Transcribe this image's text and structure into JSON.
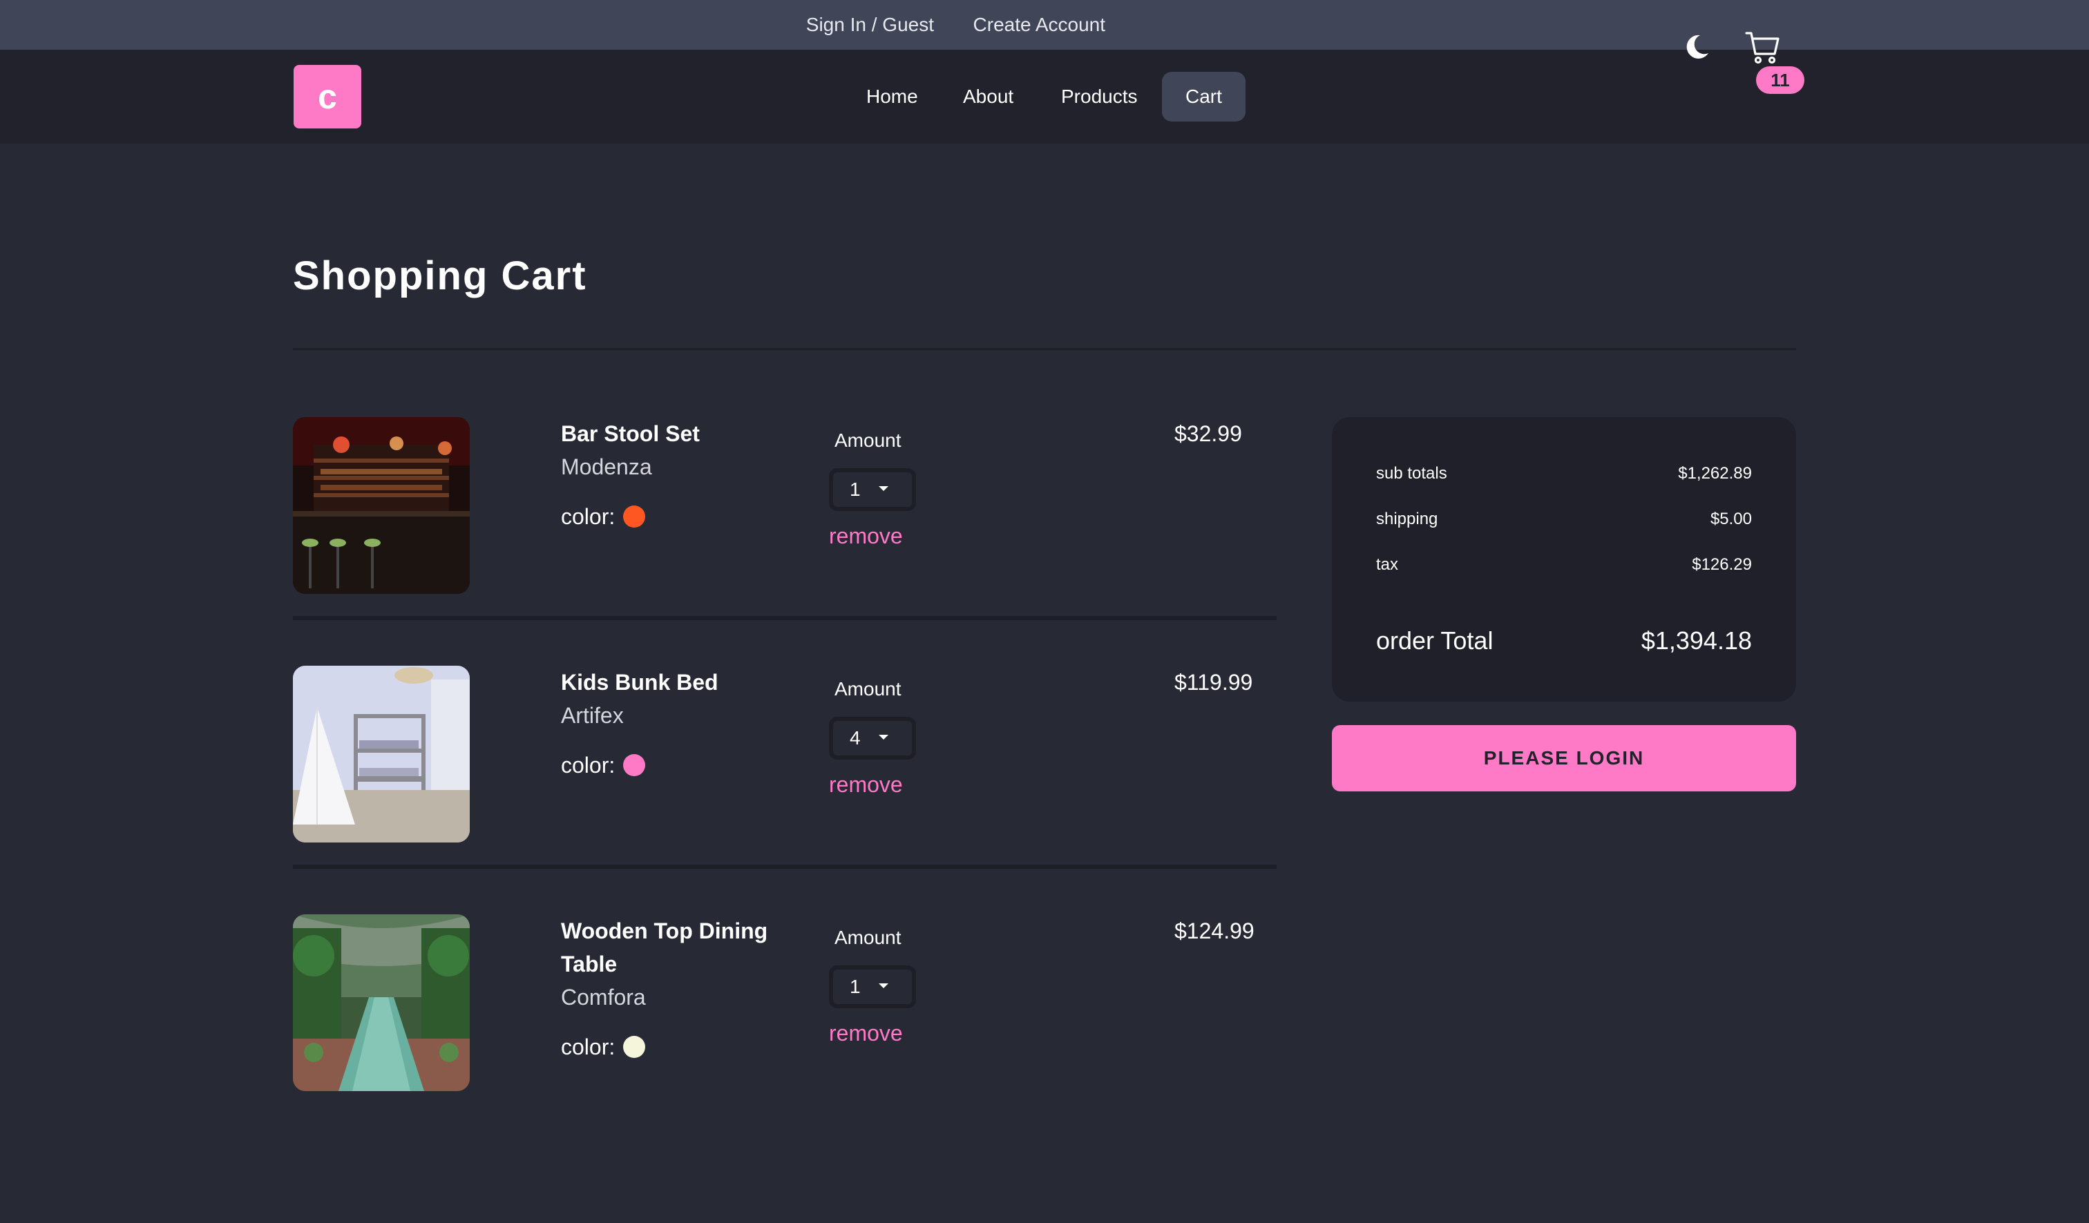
{
  "topbar": {
    "sign_in": "Sign In / Guest",
    "create_account": "Create Account"
  },
  "navbar": {
    "logo_letter": "c",
    "links": [
      {
        "label": "Home",
        "active": false
      },
      {
        "label": "About",
        "active": false
      },
      {
        "label": "Products",
        "active": false
      },
      {
        "label": "Cart",
        "active": true
      }
    ],
    "theme_icon": "moon-icon",
    "cart_icon": "cart-icon",
    "cart_count": "11"
  },
  "page": {
    "title": "Shopping Cart"
  },
  "cart": {
    "amount_label": "Amount",
    "color_label": "color:",
    "remove_label": "remove",
    "items": [
      {
        "name": "Bar Stool Set",
        "company": "Modenza",
        "color": "#ff5722",
        "amount": "1",
        "price": "$32.99"
      },
      {
        "name": "Kids Bunk Bed",
        "company": "Artifex",
        "color": "#ff7ac6",
        "amount": "4",
        "price": "$119.99"
      },
      {
        "name": "Wooden Top Dining Table",
        "company": "Comfora",
        "color": "#f5f5dc",
        "amount": "1",
        "price": "$124.99"
      }
    ]
  },
  "summary": {
    "subtotal_label": "sub totals",
    "subtotal_value": "$1,262.89",
    "shipping_label": "shipping",
    "shipping_value": "$5.00",
    "tax_label": "tax",
    "tax_value": "$126.29",
    "total_label": "order Total",
    "total_value": "$1,394.18",
    "login_button": "PLEASE LOGIN"
  },
  "colors": {
    "accent": "#ff7ac6",
    "background": "#272935",
    "navbar": "#21222c",
    "topbar": "#414558"
  }
}
